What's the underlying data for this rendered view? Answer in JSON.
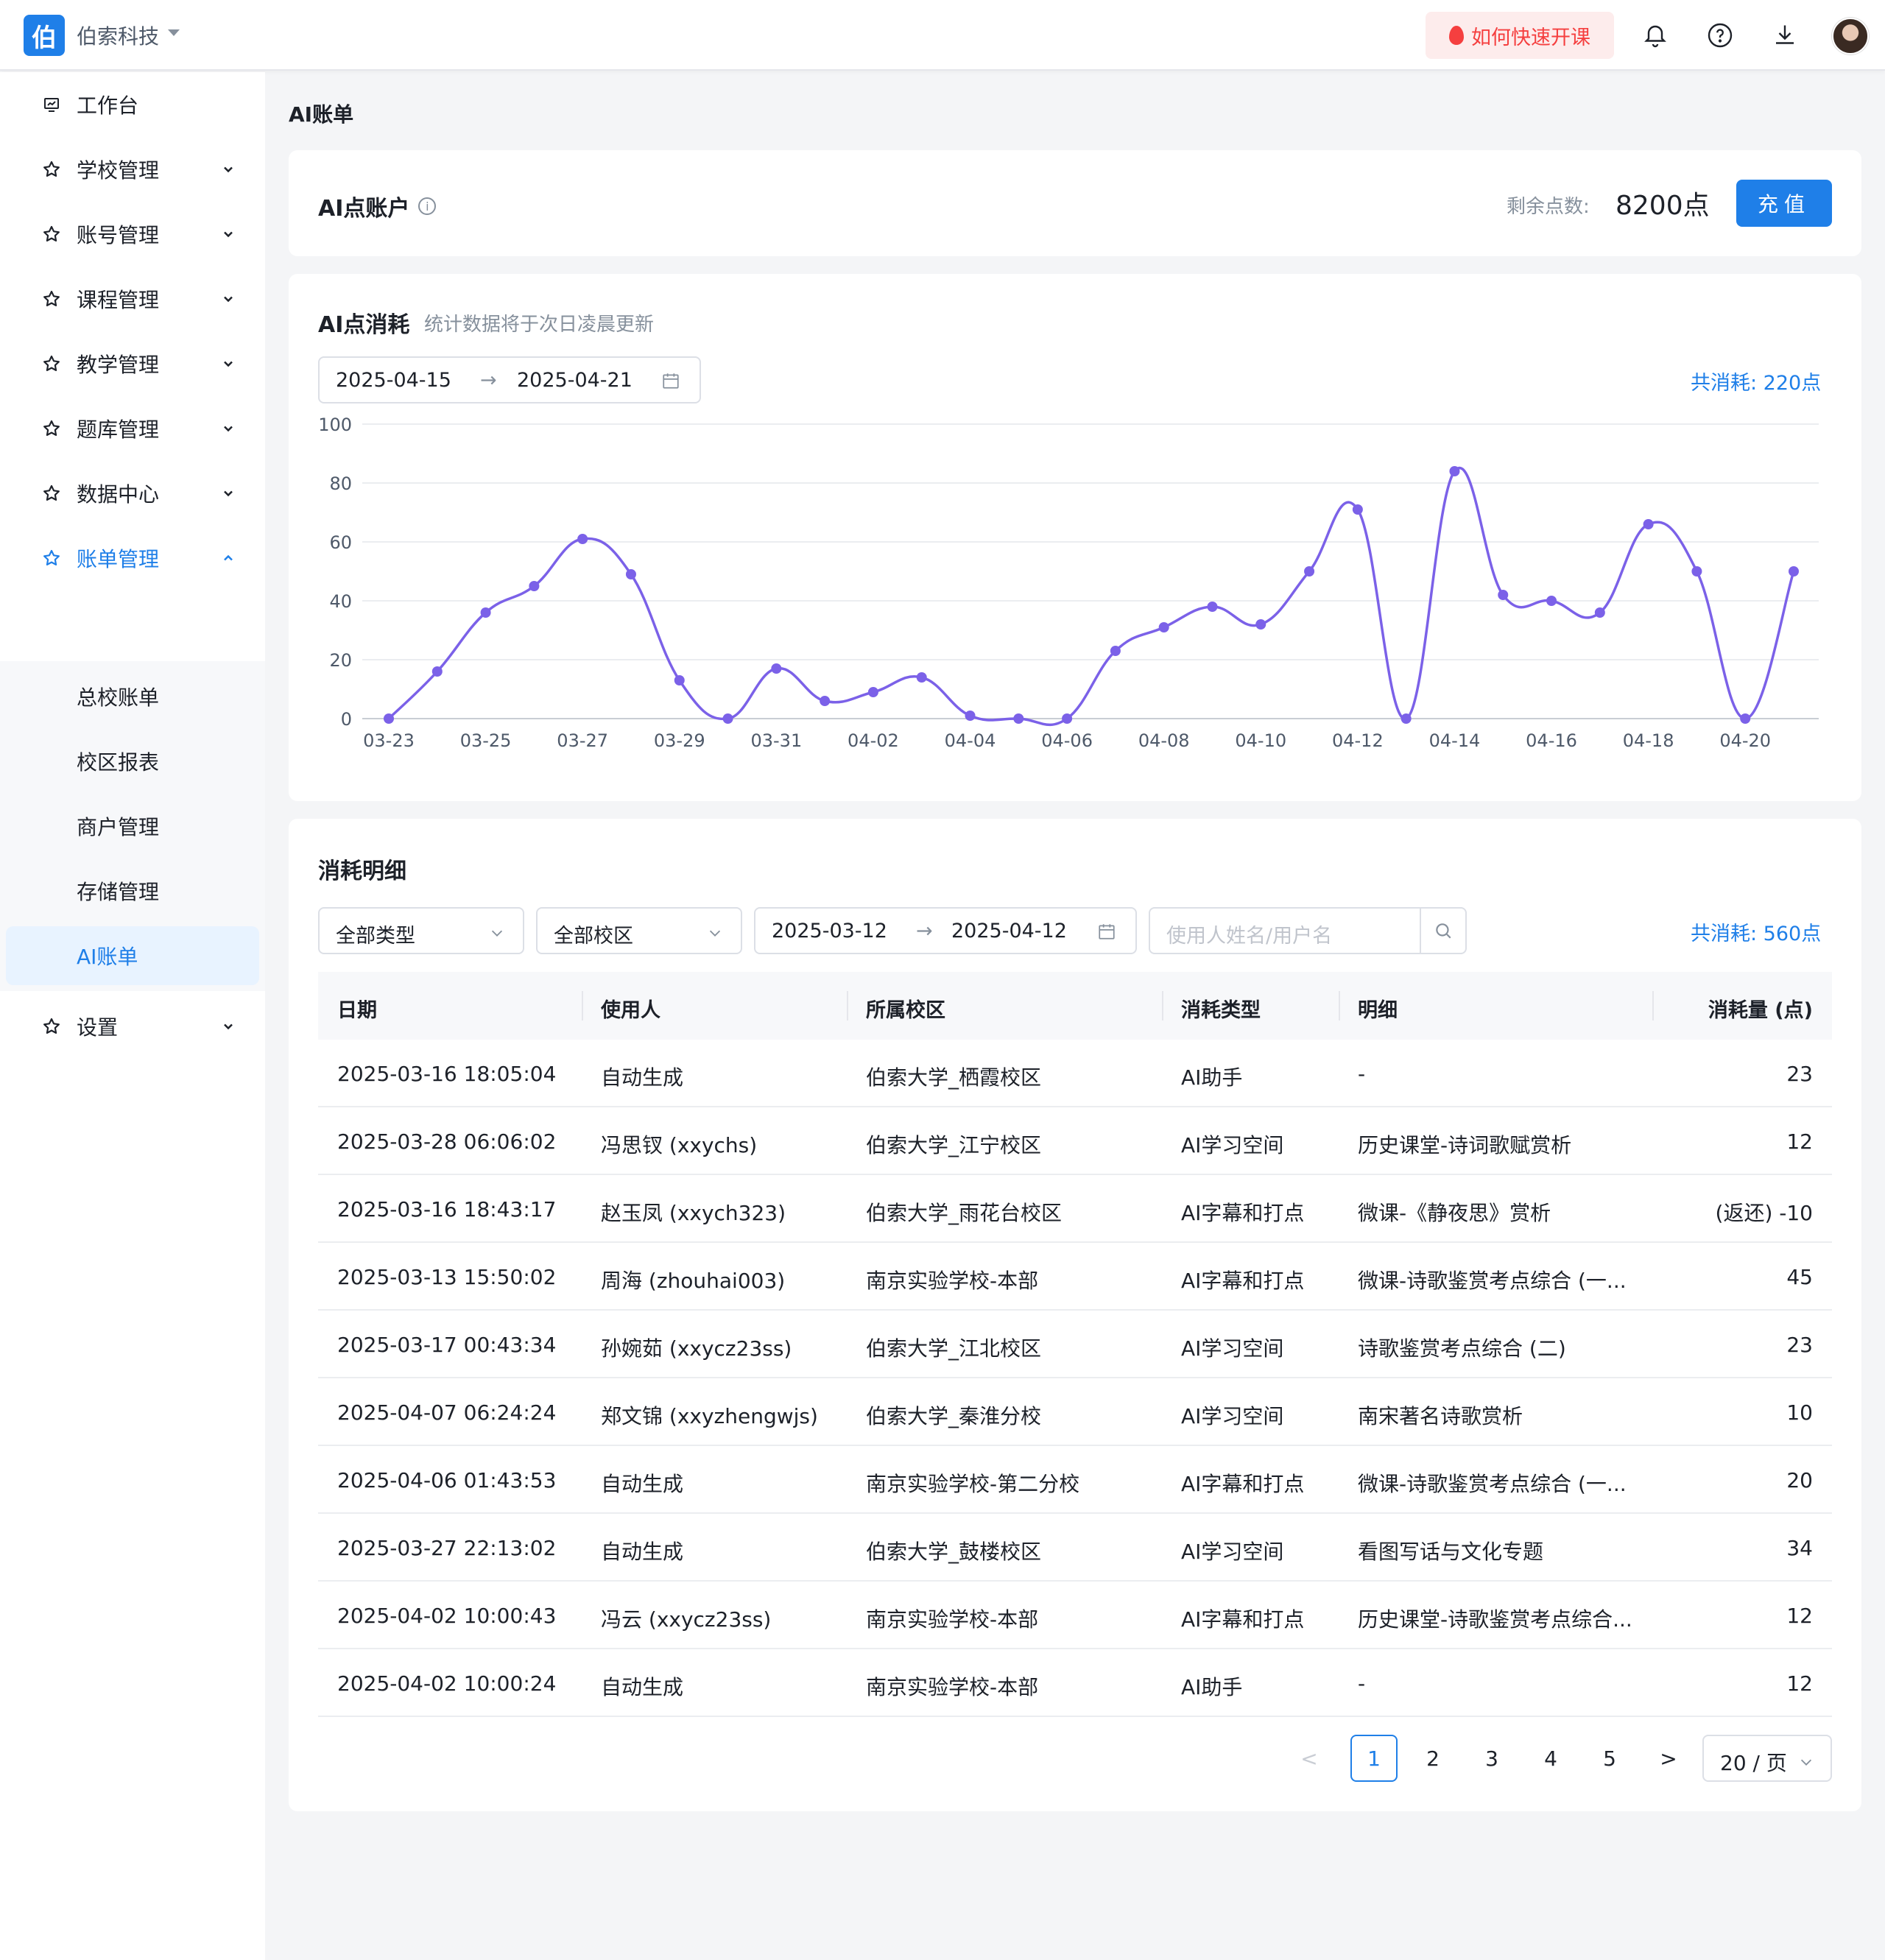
{
  "header": {
    "logo_char": "伯",
    "org_name": "伯索科技",
    "quick_start": "如何快速开课",
    "icons": [
      "bell-icon",
      "help-icon",
      "download-icon",
      "avatar"
    ]
  },
  "sidebar": {
    "items": [
      {
        "label": "工作台",
        "icon": "dashboard-icon",
        "expandable": false
      },
      {
        "label": "学校管理",
        "icon": "star-icon",
        "expandable": true
      },
      {
        "label": "账号管理",
        "icon": "star-icon",
        "expandable": true
      },
      {
        "label": "课程管理",
        "icon": "star-icon",
        "expandable": true
      },
      {
        "label": "教学管理",
        "icon": "star-icon",
        "expandable": true
      },
      {
        "label": "题库管理",
        "icon": "star-icon",
        "expandable": true
      },
      {
        "label": "数据中心",
        "icon": "star-icon",
        "expandable": true
      },
      {
        "label": "账单管理",
        "icon": "star-icon",
        "expandable": true,
        "expanded": true,
        "active": true
      }
    ],
    "sub_items": [
      {
        "label": "总校账单"
      },
      {
        "label": "校区报表"
      },
      {
        "label": "商户管理"
      },
      {
        "label": "存储管理"
      },
      {
        "label": "AI账单",
        "active": true
      }
    ],
    "settings": {
      "label": "设置",
      "icon": "star-icon"
    }
  },
  "page": {
    "title": "AI账单"
  },
  "account": {
    "title": "AI点账户",
    "remain_label": "剩余点数:",
    "remain_value": "8200点",
    "recharge_label": "充值"
  },
  "consumption": {
    "title": "AI点消耗",
    "subtitle": "统计数据将于次日凌晨更新",
    "date_start": "2025-04-15",
    "date_end": "2025-04-21",
    "total": "共消耗: 220点"
  },
  "chart_data": {
    "type": "line",
    "x": [
      "03-23",
      "03-24",
      "03-25",
      "03-26",
      "03-27",
      "03-28",
      "03-29",
      "03-30",
      "03-31",
      "04-01",
      "04-02",
      "04-03",
      "04-04",
      "04-05",
      "04-06",
      "04-07",
      "04-08",
      "04-09",
      "04-10",
      "04-11",
      "04-12",
      "04-13",
      "04-14",
      "04-15",
      "04-16",
      "04-17",
      "04-18",
      "04-19",
      "04-20",
      "04-21"
    ],
    "tick_labels": [
      "03-23",
      "03-25",
      "03-27",
      "03-29",
      "03-31",
      "04-02",
      "04-04",
      "04-06",
      "04-08",
      "04-10",
      "04-12",
      "04-14",
      "04-16",
      "04-18",
      "04-20"
    ],
    "series": [
      {
        "values": [
          0,
          16,
          36,
          45,
          61,
          49,
          13,
          0,
          17,
          6,
          9,
          14,
          1,
          0,
          0,
          23,
          31,
          38,
          32,
          50,
          71,
          0,
          84,
          42,
          40,
          36,
          66,
          50,
          0,
          50
        ]
      }
    ],
    "ylim": [
      0,
      100
    ],
    "yticks": [
      0,
      20,
      40,
      60,
      80,
      100
    ],
    "grid": true,
    "color": "#7b61e8"
  },
  "detail": {
    "title": "消耗明细",
    "filters": {
      "type_select": "全部类型",
      "campus_select": "全部校区",
      "date_start": "2025-03-12",
      "date_end": "2025-04-12",
      "search_placeholder": "使用人姓名/用户名"
    },
    "total": "共消耗: 560点",
    "columns": [
      "日期",
      "使用人",
      "所属校区",
      "消耗类型",
      "明细",
      "消耗量 (点)"
    ],
    "rows": [
      {
        "date": "2025-03-16 18:05:04",
        "user": "自动生成",
        "campus": "伯索大学_栖霞校区",
        "type": "AI助手",
        "detail": "-",
        "amount": "23"
      },
      {
        "date": "2025-03-28 06:06:02",
        "user": "冯思钗 (xxychs)",
        "campus": "伯索大学_江宁校区",
        "type": "AI学习空间",
        "detail": "历史课堂-诗词歌赋赏析",
        "amount": "12"
      },
      {
        "date": "2025-03-16 18:43:17",
        "user": "赵玉凤 (xxych323)",
        "campus": "伯索大学_雨花台校区",
        "type": "AI字幕和打点",
        "detail": "微课-《静夜思》赏析",
        "amount": "(返还) -10"
      },
      {
        "date": "2025-03-13 15:50:02",
        "user": "周海 (zhouhai003)",
        "campus": "南京实验学校-本部",
        "type": "AI字幕和打点",
        "detail": "微课-诗歌鉴赏考点综合 (一...",
        "amount": "45"
      },
      {
        "date": "2025-03-17 00:43:34",
        "user": "孙婉茹 (xxycz23ss)",
        "campus": "伯索大学_江北校区",
        "type": "AI学习空间",
        "detail": "诗歌鉴赏考点综合 (二)",
        "amount": "23"
      },
      {
        "date": "2025-04-07 06:24:24",
        "user": "郑文锦 (xxyzhengwjs)",
        "campus": "伯索大学_秦淮分校",
        "type": "AI学习空间",
        "detail": "南宋著名诗歌赏析",
        "amount": "10"
      },
      {
        "date": "2025-04-06 01:43:53",
        "user": "自动生成",
        "campus": "南京实验学校-第二分校",
        "type": "AI字幕和打点",
        "detail": "微课-诗歌鉴赏考点综合 (一...",
        "amount": "20"
      },
      {
        "date": "2025-03-27 22:13:02",
        "user": "自动生成",
        "campus": "伯索大学_鼓楼校区",
        "type": "AI学习空间",
        "detail": "看图写话与文化专题",
        "amount": "34"
      },
      {
        "date": "2025-04-02 10:00:43",
        "user": "冯云 (xxycz23ss)",
        "campus": "南京实验学校-本部",
        "type": "AI字幕和打点",
        "detail": "历史课堂-诗歌鉴赏考点综合...",
        "amount": "12"
      },
      {
        "date": "2025-04-02 10:00:24",
        "user": "自动生成",
        "campus": "南京实验学校-本部",
        "type": "AI助手",
        "detail": "-",
        "amount": "12"
      }
    ],
    "pagination": {
      "prev": "<",
      "pages": [
        "1",
        "2",
        "3",
        "4",
        "5"
      ],
      "current": "1",
      "next": ">",
      "page_size": "20 / 页"
    }
  }
}
